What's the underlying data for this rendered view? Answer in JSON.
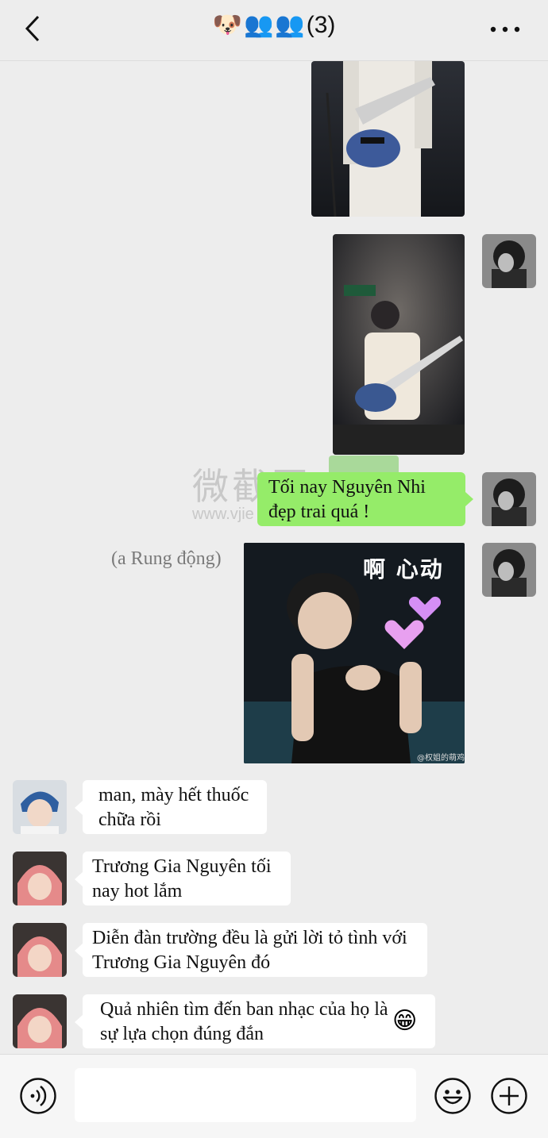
{
  "header": {
    "title_emojis": [
      "🐶",
      "👥",
      "👥"
    ],
    "title_count": "(3)"
  },
  "messages": {
    "m1": {
      "text": "Tối nay Nguyên Nhi đẹp trai quá !"
    },
    "m2": {
      "caption": "(a Rung động)",
      "sticker_text": "啊 心动",
      "sticker_credit": "@权姐的萌鸡"
    },
    "m3": {
      "text": "man, mày hết thuốc chữa rồi"
    },
    "m4": {
      "text": "Trương Gia Nguyên tối nay hot lắm"
    },
    "m5": {
      "text": "Diễn đàn trường đều là gửi lời tỏ tình với Trương Gia Nguyên đó"
    },
    "m6": {
      "text": "Quả nhiên tìm đến ban nhạc của họ là sự lựa chọn đúng đắn",
      "emoji": "😁"
    }
  },
  "watermark": {
    "text_cn": "微截图",
    "text_url": "www.vjie"
  },
  "icons": {
    "back": "chevron-left-icon",
    "more": "more-dots-icon",
    "voice": "voice-icon",
    "emoji": "smiley-icon",
    "add": "plus-icon"
  },
  "colors": {
    "background": "#ededed",
    "bubble_self": "#95ec69",
    "bubble_other": "#ffffff"
  }
}
